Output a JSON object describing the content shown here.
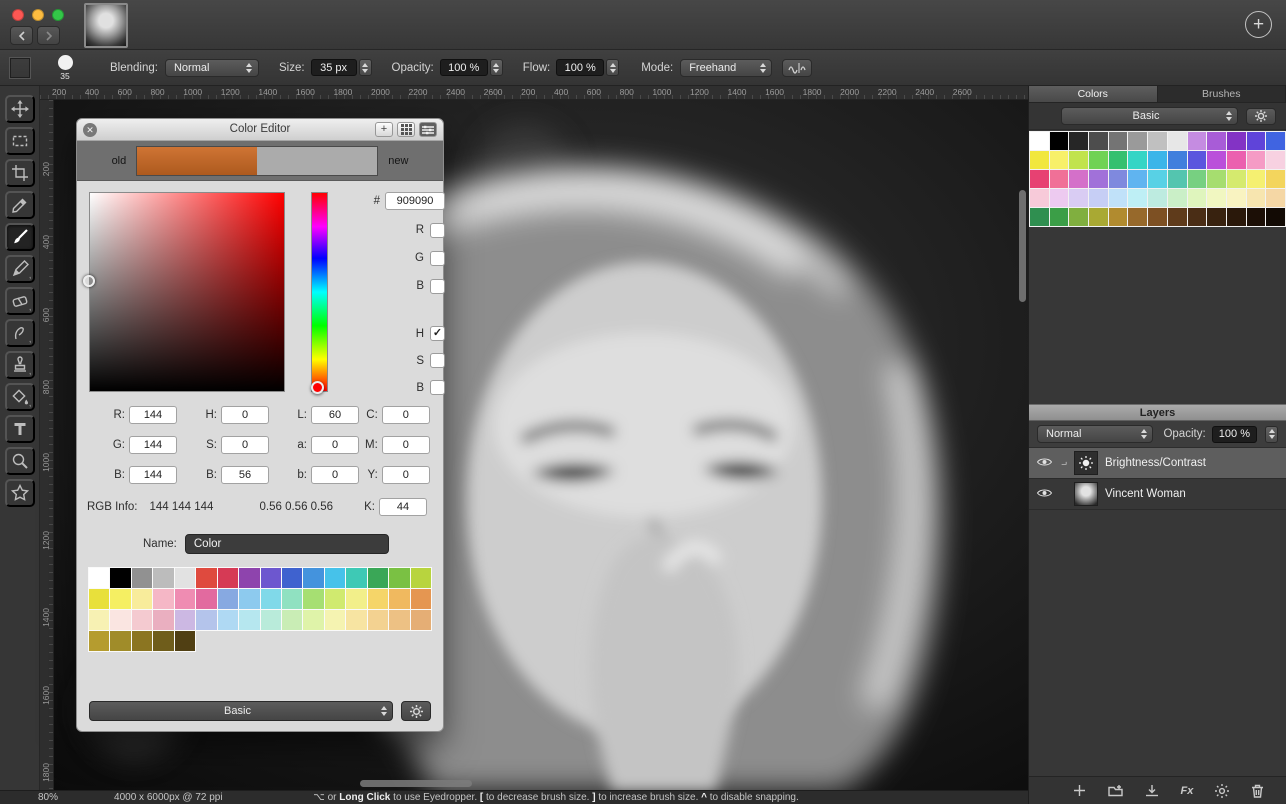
{
  "accent_colors": {
    "current_color": "#909090",
    "old_color": "#c2672c",
    "new_color": "#ababab",
    "selected_layer_bg": "#5e5e5e"
  },
  "icons": {
    "plus": "+",
    "check": "✓",
    "close": "✕",
    "fx": "Fx",
    "clip_indicator": "⌐"
  },
  "toolbar": {
    "brush_size_badge": "35",
    "blending": {
      "label": "Blending:",
      "value": "Normal"
    },
    "size": {
      "label": "Size:",
      "value": "35 px"
    },
    "opacity": {
      "label": "Opacity:",
      "value": "100 %"
    },
    "flow": {
      "label": "Flow:",
      "value": "100 %"
    },
    "mode": {
      "label": "Mode:",
      "value": "Freehand"
    }
  },
  "tools": [
    "move",
    "rectangular-selection",
    "crop",
    "eyedropper",
    "paint-brush",
    "pencil",
    "eraser",
    "smudge",
    "clone-stamp",
    "fill",
    "type",
    "zoom",
    "shapes"
  ],
  "rulers": {
    "horizontal": [
      "200",
      "400",
      "600",
      "800",
      "1000",
      "1200",
      "1400",
      "1600",
      "1800",
      "2000",
      "2200",
      "2400",
      "2600"
    ],
    "vertical": [
      "200",
      "400",
      "600",
      "800",
      "1000",
      "1200",
      "1400",
      "1600",
      "1800"
    ]
  },
  "color_editor": {
    "title": "Color Editor",
    "old_label": "old",
    "new_label": "new",
    "hex_label": "#",
    "hex_value": "909090",
    "rgb_checks": [
      {
        "label": "R",
        "checked": false
      },
      {
        "label": "G",
        "checked": false
      },
      {
        "label": "B",
        "checked": false
      }
    ],
    "hsb_checks": [
      {
        "label": "H",
        "checked": true
      },
      {
        "label": "S",
        "checked": false
      },
      {
        "label": "B",
        "checked": false
      }
    ],
    "fields": {
      "r": {
        "label": "R:",
        "value": "144"
      },
      "g": {
        "label": "G:",
        "value": "144"
      },
      "b": {
        "label": "B:",
        "value": "144"
      },
      "h": {
        "label": "H:",
        "value": "0"
      },
      "s": {
        "label": "S:",
        "value": "0"
      },
      "b2": {
        "label": "B:",
        "value": "56"
      },
      "l": {
        "label": "L:",
        "value": "60"
      },
      "a": {
        "label": "a:",
        "value": "0"
      },
      "bb": {
        "label": "b:",
        "value": "0"
      },
      "c": {
        "label": "C:",
        "value": "0"
      },
      "m": {
        "label": "M:",
        "value": "0"
      },
      "y": {
        "label": "Y:",
        "value": "0"
      },
      "k": {
        "label": "K:",
        "value": "44"
      }
    },
    "rgb_info": {
      "label": "RGB Info:",
      "ints": "144 144 144",
      "floats": "0.56 0.56 0.56"
    },
    "name": {
      "label": "Name:",
      "value": "Color"
    },
    "preset": "Basic",
    "palette": [
      "#ffffff",
      "#000000",
      "#919191",
      "#bcbcbc",
      "#e2e2e2",
      "#df4a3e",
      "#d63a55",
      "#8e44ad",
      "#6d57cf",
      "#3f62cf",
      "#4493dd",
      "#46c2ea",
      "#3ec9b5",
      "#3aa757",
      "#7ac143",
      "#b8d43e",
      "#e8e03b",
      "#f5ef62",
      "#f8ec9b",
      "#f5b7c6",
      "#ef8cb2",
      "#e26a9f",
      "#87a9e1",
      "#8dcaee",
      "#80d9e9",
      "#90e1c1",
      "#a6df72",
      "#d0ea6f",
      "#f2ef8a",
      "#f5d569",
      "#f0b95f",
      "#e59651",
      "#f7f1b3",
      "#fae5e1",
      "#f4cad0",
      "#eaafc0",
      "#ccb8e3",
      "#b4c4eb",
      "#afd9f3",
      "#b6e7ef",
      "#b9ebda",
      "#c9edb5",
      "#dff3a9",
      "#f5f3b1",
      "#f7e4a2",
      "#f3d291",
      "#edc184",
      "#e5ae75",
      "#b59c2f",
      "#a08c29",
      "#8b7521",
      "#6f5d1b",
      "#503f13"
    ]
  },
  "colors_panel": {
    "tabs": [
      "Colors",
      "Brushes"
    ],
    "active_tab": "Colors",
    "preset": "Basic",
    "palette": [
      "#ffffff",
      "#000000",
      "#262626",
      "#4d4d4d",
      "#747474",
      "#9a9a9a",
      "#c0c0c0",
      "#e7e7e7",
      "#c58ce1",
      "#a85cd7",
      "#8333c5",
      "#5f44d9",
      "#4064e1",
      "#f1e73d",
      "#f7f069",
      "#c1e34d",
      "#70d254",
      "#34c06f",
      "#34d5c5",
      "#3bb5e9",
      "#407fdd",
      "#5b55de",
      "#ba50da",
      "#eb60af",
      "#f59bc5",
      "#f7d1e1",
      "#e74172",
      "#f07097",
      "#d470c9",
      "#a171d9",
      "#7f89de",
      "#60b4f0",
      "#58d1e5",
      "#54c5af",
      "#77d081",
      "#a6dd6f",
      "#d5ea6e",
      "#f5f071",
      "#f3d55d",
      "#f7cad9",
      "#edcaf0",
      "#d9ccf3",
      "#c6cef5",
      "#c0e1f9",
      "#beeff5",
      "#bdebe0",
      "#caefc7",
      "#dff5bd",
      "#f1f7c1",
      "#f9f3c1",
      "#f7e5af",
      "#f5d7a5",
      "#2f8f50",
      "#3b9e47",
      "#80af3f",
      "#a9a933",
      "#b18b2f",
      "#97692b",
      "#7d5023",
      "#5f3b1b",
      "#4a2d15",
      "#38220f",
      "#2a180a",
      "#1c0f06",
      "#120a04"
    ]
  },
  "layers_panel": {
    "title": "Layers",
    "blend": "Normal",
    "opacity_label": "Opacity:",
    "opacity_value": "100 %",
    "items": [
      {
        "name": "Brightness/Contrast",
        "type": "adjustment",
        "visible": true,
        "selected": true
      },
      {
        "name": "Vincent Woman",
        "type": "image",
        "visible": true,
        "selected": false
      }
    ]
  },
  "statusbar": {
    "zoom": "80%",
    "doc_info": "4000 x 6000px @ 72 ppi",
    "hint_parts": [
      {
        "t": "⌥ or "
      },
      {
        "t": "Long Click",
        "b": true
      },
      {
        "t": " to use Eyedropper.  "
      },
      {
        "t": "[",
        "b": true
      },
      {
        "t": " to decrease brush size.  "
      },
      {
        "t": "]",
        "b": true
      },
      {
        "t": " to increase brush size.  "
      },
      {
        "t": "^",
        "b": true
      },
      {
        "t": " to disable snapping."
      }
    ]
  }
}
